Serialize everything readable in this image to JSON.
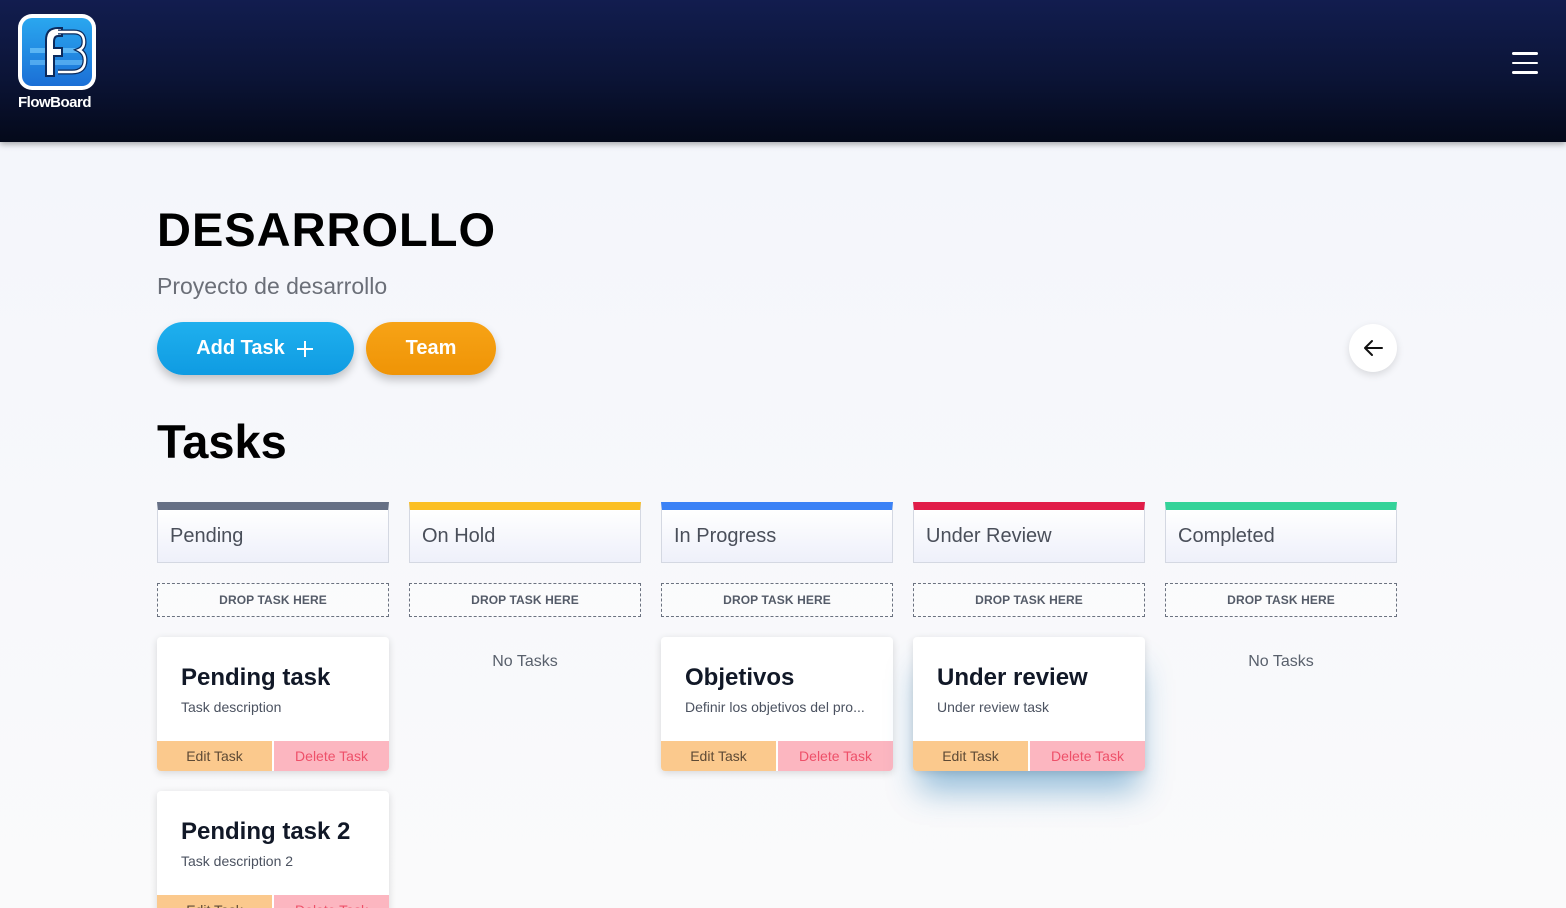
{
  "app": {
    "logo_text": "FlowBoard"
  },
  "project": {
    "title": "DESARROLLO",
    "description": "Proyecto de desarrollo",
    "add_task_label": "Add Task",
    "team_label": "Team"
  },
  "tasks_heading": "Tasks",
  "drop_label": "DROP TASK HERE",
  "no_tasks_label": "No Tasks",
  "edit_label": "Edit Task",
  "delete_label": "Delete Task",
  "colors": {
    "pending": "#667085",
    "on_hold": "#fbbf24",
    "in_progress": "#3b82f6",
    "under_review": "#e11d48",
    "completed": "#34d399",
    "add_button": "#0ea5e9",
    "team_button": "#f59e0b"
  },
  "columns": [
    {
      "name": "Pending",
      "color": "#667085",
      "tasks": [
        {
          "title": "Pending task",
          "description": "Task description"
        },
        {
          "title": "Pending task 2",
          "description": "Task description 2"
        }
      ]
    },
    {
      "name": "On Hold",
      "color": "#fbbf24",
      "tasks": []
    },
    {
      "name": "In Progress",
      "color": "#3b82f6",
      "tasks": [
        {
          "title": "Objetivos",
          "description": "Definir los objetivos del pro..."
        }
      ]
    },
    {
      "name": "Under Review",
      "color": "#e11d48",
      "tasks": [
        {
          "title": "Under review",
          "description": "Under review task"
        }
      ]
    },
    {
      "name": "Completed",
      "color": "#34d399",
      "tasks": []
    }
  ]
}
